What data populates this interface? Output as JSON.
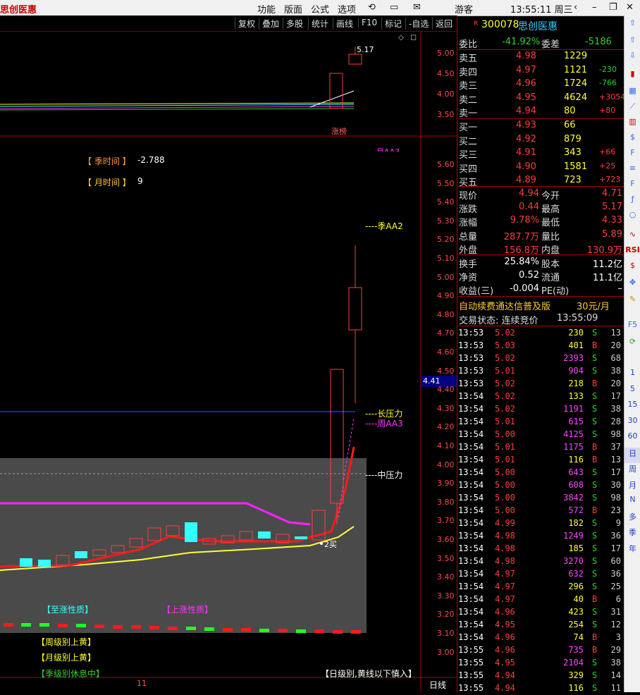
{
  "app": {
    "title": "思创医惠",
    "topmenu": [
      "功能",
      "版面",
      "公式",
      "选项"
    ],
    "user": "游客",
    "clock": "13:55:11 周三"
  },
  "toolbar": [
    "复权",
    "叠加",
    "多股",
    "统计",
    "画线",
    "F10",
    "标记",
    "-自选",
    "返回"
  ],
  "stock": {
    "flag": "R",
    "code": "300078",
    "name": "思创医惠"
  },
  "orderbook": {
    "weibi_label": "委比",
    "weibi": "-41.92%",
    "weicha_label": "委差",
    "weicha": "-5186",
    "asks": [
      {
        "label": "卖五",
        "price": "4.98",
        "vol": "1229",
        "chg": ""
      },
      {
        "label": "卖四",
        "price": "4.97",
        "vol": "1121",
        "chg": "-230"
      },
      {
        "label": "卖三",
        "price": "4.96",
        "vol": "1724",
        "chg": "-766"
      },
      {
        "label": "卖二",
        "price": "4.95",
        "vol": "4624",
        "chg": "+3054"
      },
      {
        "label": "卖一",
        "price": "4.94",
        "vol": "80",
        "chg": "+80"
      }
    ],
    "bids": [
      {
        "label": "买一",
        "price": "4.93",
        "vol": "66",
        "chg": ""
      },
      {
        "label": "买二",
        "price": "4.92",
        "vol": "879",
        "chg": ""
      },
      {
        "label": "买三",
        "price": "4.91",
        "vol": "343",
        "chg": "+66"
      },
      {
        "label": "买四",
        "price": "4.90",
        "vol": "1581",
        "chg": "+25"
      },
      {
        "label": "买五",
        "price": "4.89",
        "vol": "723",
        "chg": "+723"
      }
    ]
  },
  "quote": [
    {
      "l1": "现价",
      "v1": "4.94",
      "l2": "今开",
      "v2": "4.71"
    },
    {
      "l1": "涨跌",
      "v1": "0.44",
      "l2": "最高",
      "v2": "5.17"
    },
    {
      "l1": "涨幅",
      "v1": "9.78%",
      "l2": "最低",
      "v2": "4.33"
    },
    {
      "l1": "总量",
      "v1": "287.7万",
      "l2": "量比",
      "v2": "5.89"
    },
    {
      "l1": "外盘",
      "v1": "156.8万",
      "l2": "内盘",
      "v2": "130.9万"
    }
  ],
  "fund": [
    {
      "l1": "换手",
      "v1": "25.84%",
      "l2": "股本",
      "v2": "11.2亿"
    },
    {
      "l1": "净资",
      "v1": "0.52",
      "l2": "流通",
      "v2": "11.1亿"
    },
    {
      "l1": "收益(三)",
      "v1": "-0.004",
      "l2": "PE(动)",
      "v2": "–"
    }
  ],
  "ad": {
    "text": "自动续费通达信普及版",
    "price": "30元/月"
  },
  "status": {
    "label": "交易状态: 连续竞价",
    "time": "13:55:09"
  },
  "trades": [
    [
      "13:53",
      "5.02",
      "230",
      "S",
      "13"
    ],
    [
      "13:53",
      "5.03",
      "401",
      "B",
      "20"
    ],
    [
      "13:53",
      "5.02",
      "2393",
      "S",
      "68"
    ],
    [
      "13:53",
      "5.01",
      "904",
      "S",
      "38"
    ],
    [
      "13:53",
      "5.02",
      "218",
      "B",
      "20"
    ],
    [
      "13:54",
      "5.02",
      "133",
      "S",
      "17"
    ],
    [
      "13:54",
      "5.02",
      "1191",
      "S",
      "38"
    ],
    [
      "13:54",
      "5.01",
      "615",
      "S",
      "28"
    ],
    [
      "13:54",
      "5.00",
      "4125",
      "S",
      "98"
    ],
    [
      "13:54",
      "5.01",
      "1175",
      "B",
      "37"
    ],
    [
      "13:54",
      "5.01",
      "116",
      "B",
      "13"
    ],
    [
      "13:54",
      "5.00",
      "643",
      "S",
      "17"
    ],
    [
      "13:54",
      "5.00",
      "608",
      "S",
      "30"
    ],
    [
      "13:54",
      "5.00",
      "3842",
      "S",
      "98"
    ],
    [
      "13:54",
      "5.00",
      "572",
      "B",
      "23"
    ],
    [
      "13:54",
      "4.99",
      "182",
      "S",
      "9"
    ],
    [
      "13:54",
      "4.98",
      "1249",
      "S",
      "36"
    ],
    [
      "13:54",
      "4.98",
      "185",
      "S",
      "17"
    ],
    [
      "13:54",
      "4.98",
      "3270",
      "S",
      "60"
    ],
    [
      "13:54",
      "4.97",
      "632",
      "S",
      "36"
    ],
    [
      "13:54",
      "4.97",
      "296",
      "S",
      "25"
    ],
    [
      "13:54",
      "4.97",
      "40",
      "B",
      "6"
    ],
    [
      "13:54",
      "4.96",
      "423",
      "S",
      "31"
    ],
    [
      "13:54",
      "4.95",
      "254",
      "S",
      "12"
    ],
    [
      "13:54",
      "4.96",
      "74",
      "B",
      "3"
    ],
    [
      "13:55",
      "4.96",
      "735",
      "B",
      "29"
    ],
    [
      "13:55",
      "4.95",
      "2104",
      "S",
      "38"
    ],
    [
      "13:55",
      "4.94",
      "329",
      "S",
      "14"
    ],
    [
      "13:55",
      "4.94",
      "116",
      "S",
      "11"
    ]
  ],
  "chart": {
    "upper_ticks": [
      "5.00",
      "4.50",
      "4.00",
      "3.50"
    ],
    "upper_high": "5.17",
    "upper_tag": "涨榜",
    "main_ticks": [
      "5.60",
      "5.50",
      "5.40",
      "5.30",
      "5.20",
      "5.10",
      "5.00",
      "4.90",
      "4.80",
      "4.70",
      "4.60",
      "4.50",
      "4.40",
      "4.30",
      "4.20",
      "4.10",
      "4.00",
      "3.90",
      "3.80",
      "3.70",
      "3.60",
      "3.50",
      "3.40",
      "3.30",
      "3.20",
      "3.10",
      "3.00"
    ],
    "current_price_tag": "4.41",
    "indicators": [
      {
        "label": "【 季时间 】",
        "value": "-2.788"
      },
      {
        "label": "【 月时间 】",
        "value": "9"
      }
    ],
    "line_labels": {
      "month": "----月AA3",
      "season": "----季AA2",
      "long": "----长压力",
      "week": "----周AA3",
      "mid": "----中压力"
    },
    "buy_label": "2买",
    "sig1": "【至涨性质】",
    "sig2": "【上涨性质】",
    "sig3": "【周级别上黄】",
    "sig4": "【月级别上黄】",
    "sig5": "【季级别休息中】",
    "sig6": "【日级别,黄线以下慎入】",
    "period": "日线",
    "axis_tick": "11"
  },
  "sidebar": [
    "1",
    "5",
    "15",
    "30",
    "60",
    "日",
    "周",
    "月",
    "N",
    "多",
    "季",
    "年"
  ]
}
